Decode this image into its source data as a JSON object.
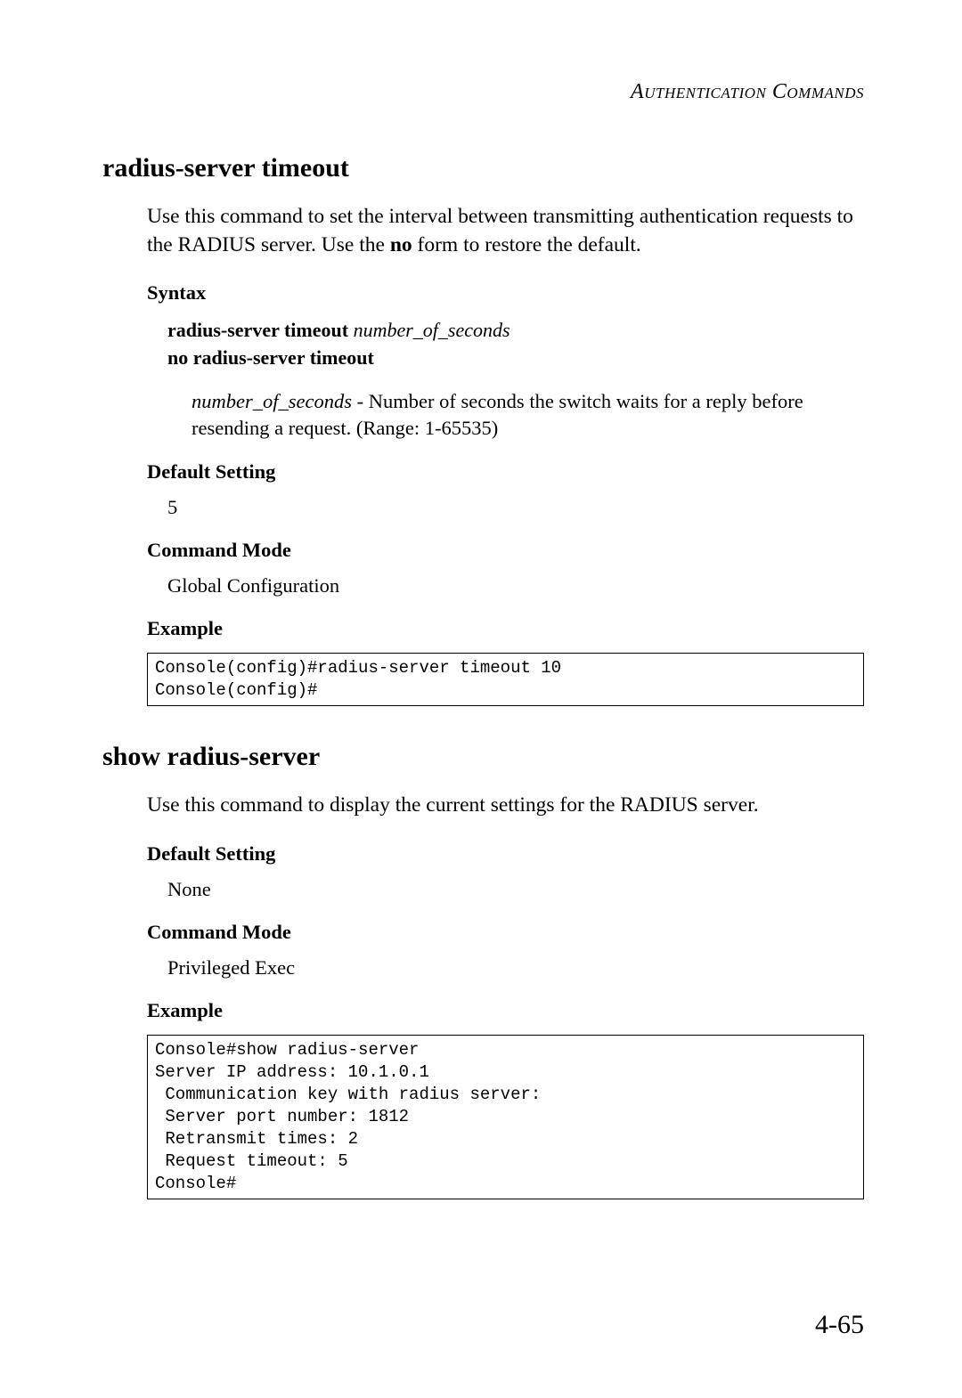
{
  "header": {
    "running_head": "Authentication Commands"
  },
  "section1": {
    "title": "radius-server timeout",
    "intro": "Use this command to set the interval between transmitting authentication requests to the RADIUS server. Use the ",
    "intro_bold": "no",
    "intro_after": " form to restore the default.",
    "syntax_label": "Syntax",
    "syntax_cmd_bold": "radius-server timeout ",
    "syntax_cmd_italic": "number_of_seconds",
    "syntax_no": "no radius-server timeout",
    "param_name": "number_of_seconds",
    "param_sep": " - ",
    "param_desc": "Number of seconds the switch waits for a reply before resending a request. (Range: 1-65535)",
    "default_label": "Default Setting",
    "default_value": "5",
    "mode_label": "Command Mode",
    "mode_value": "Global Configuration",
    "example_label": "Example",
    "example_code": "Console(config)#radius-server timeout 10\nConsole(config)#"
  },
  "section2": {
    "title": "show radius-server",
    "intro": "Use this command to display the current settings for the RADIUS server.",
    "default_label": "Default Setting",
    "default_value": "None",
    "mode_label": "Command Mode",
    "mode_value": "Privileged Exec",
    "example_label": "Example",
    "example_code": "Console#show radius-server\nServer IP address: 10.1.0.1\n Communication key with radius server:\n Server port number: 1812\n Retransmit times: 2\n Request timeout: 5\nConsole#"
  },
  "footer": {
    "page_number": "4-65"
  }
}
